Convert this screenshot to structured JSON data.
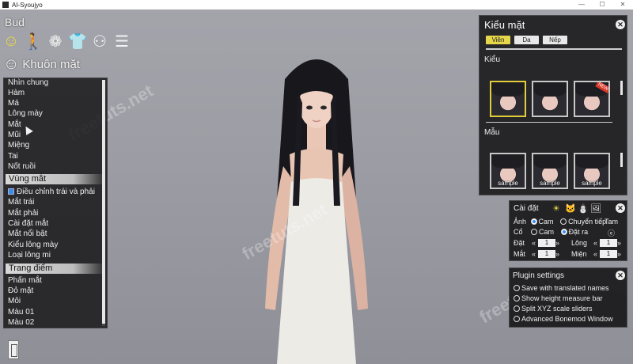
{
  "window": {
    "title": "AI-Syoujyo",
    "controls": [
      "—",
      "☐",
      "✕"
    ]
  },
  "watermark": "freetuts.net",
  "mode_label": "Bud",
  "toolbar": {
    "items": [
      {
        "icon": "smiley-face-icon",
        "glyph": "☺"
      },
      {
        "icon": "body-figure-icon",
        "glyph": "🚶"
      },
      {
        "icon": "hair-icon",
        "glyph": "❁"
      },
      {
        "icon": "clothing-icon",
        "glyph": "👕"
      },
      {
        "icon": "ring-accessory-icon",
        "glyph": "⚇"
      },
      {
        "icon": "list-menu-icon",
        "glyph": "☰"
      }
    ]
  },
  "section": {
    "glyph": "☺",
    "title": "Khuôn mặt"
  },
  "left_menu": {
    "group1": [
      "Nhìn chung",
      "Hàm",
      "Má",
      "Lông mày",
      "Mắt",
      "Mũi",
      "Miệng",
      "Tai",
      "Nốt ruồi"
    ],
    "head2": "Vùng mắt",
    "checkbox_label": "Điều chỉnh trái và phải",
    "group2": [
      "Mắt trái",
      "Mắt phải",
      "Cài đặt mắt",
      "Mắt nổi bật",
      "Kiểu lông mày",
      "Loại lông mi"
    ],
    "head3": "Trang điểm",
    "group3": [
      "Phấn mắt",
      "Đỏ mặt",
      "Môi",
      "Màu 01",
      "Màu 02"
    ]
  },
  "face_panel": {
    "title": "Kiểu mặt",
    "tabs": [
      "Viền",
      "Da",
      "Nếp"
    ],
    "label_style": "Kiểu",
    "label_template": "Mẫu",
    "new_badge": "NEW",
    "sample_label": "sample",
    "close": "✕"
  },
  "settings": {
    "title": "Cài đặt",
    "icons": [
      "☀",
      "🐱",
      "⛄",
      "🖼"
    ],
    "row1": {
      "label": "Ảnh",
      "opt1": "Cam",
      "opt2": "Chuyển tiếp",
      "extra": "Tam"
    },
    "row2": {
      "label": "Cổ",
      "opt1": "Cam",
      "opt2": "Đặt ra",
      "extra": "ⓔ"
    },
    "stepper_rows": [
      {
        "left_label": "Đặt",
        "left_value": "1",
        "right_label": "Lông",
        "right_value": "1"
      },
      {
        "left_label": "Mắt",
        "left_value": "1",
        "right_label": "Miện",
        "right_value": "1"
      }
    ],
    "close": "✕"
  },
  "plugin": {
    "title": "Plugin settings",
    "options": [
      "Save with translated names",
      "Show height measure bar",
      "Split XYZ scale sliders",
      "Advanced Bonemod Window"
    ],
    "close": "✕"
  }
}
